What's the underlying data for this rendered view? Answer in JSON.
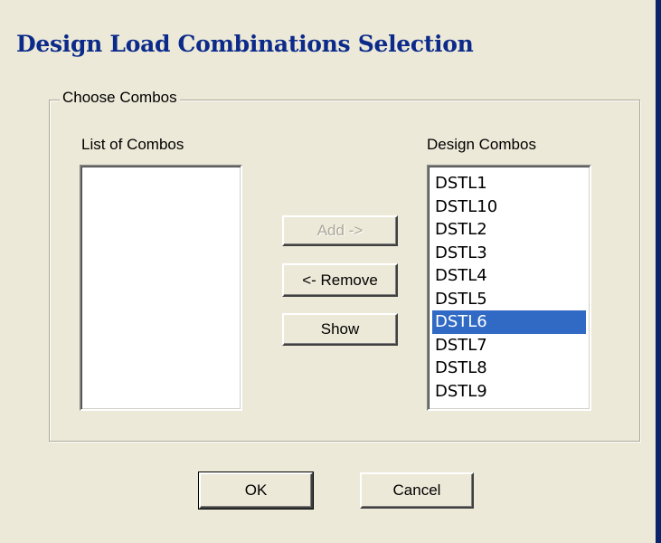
{
  "window": {
    "title": "Design Load Combinations Selection"
  },
  "group": {
    "legend": "Choose Combos"
  },
  "list_of_combos": {
    "label": "List of Combos",
    "items": []
  },
  "design_combos": {
    "label": "Design Combos",
    "items": [
      "DSTL1",
      "DSTL10",
      "DSTL2",
      "DSTL3",
      "DSTL4",
      "DSTL5",
      "DSTL6",
      "DSTL7",
      "DSTL8",
      "DSTL9"
    ],
    "selected": "DSTL6"
  },
  "buttons": {
    "add": "Add ->",
    "remove": "<- Remove",
    "show": "Show",
    "ok": "OK",
    "cancel": "Cancel"
  },
  "colors": {
    "title": "#0b2a8a",
    "selection": "#316ac5",
    "dialog_bg": "#ece9d8"
  }
}
